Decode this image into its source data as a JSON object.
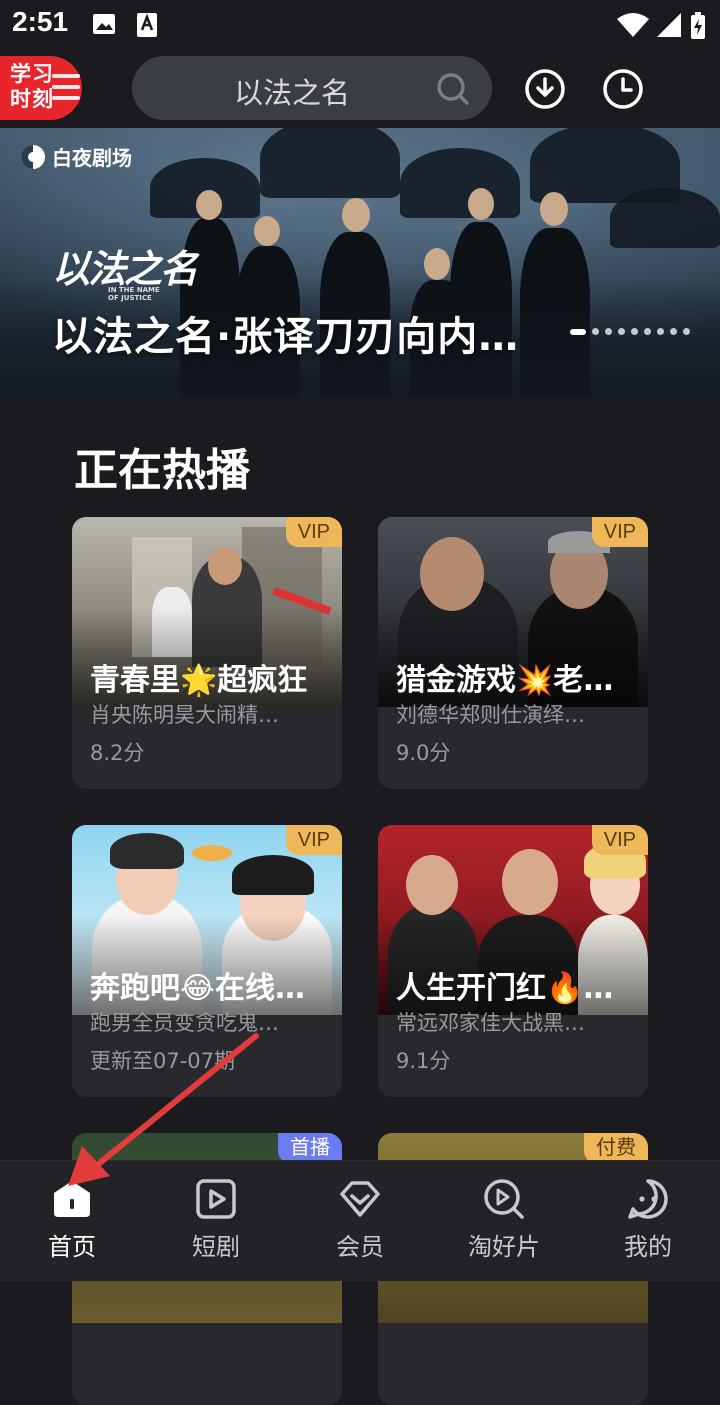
{
  "status_bar": {
    "time": "2:51"
  },
  "header": {
    "badge_text": "学习时刻",
    "search_placeholder": "以法之名"
  },
  "banner": {
    "channel": "白夜剧场",
    "brand_calligraphy": "以法之名",
    "brand_en": "IN THE NAME OF JUSTICE",
    "title": "以法之名·张译刀刃向内…",
    "dot_count": 9,
    "active_dot": 0
  },
  "section": {
    "title": "正在热播"
  },
  "cards": [
    {
      "tag": "VIP",
      "title": "青春里🌟超疯狂",
      "subtitle": "肖央陈明昊大闹精…",
      "meta": "8.2分"
    },
    {
      "tag": "VIP",
      "title": "猎金游戏💥老…",
      "subtitle": "刘德华郑则仕演绎…",
      "meta": "9.0分"
    },
    {
      "tag": "VIP",
      "title": "奔跑吧😂在线…",
      "subtitle": "跑男全员变贪吃鬼…",
      "meta": "更新至07-07期"
    },
    {
      "tag": "VIP",
      "title": "人生开门红🔥…",
      "subtitle": "常远邓家佳大战黑…",
      "meta": "9.1分"
    },
    {
      "tag": "首播"
    },
    {
      "tag": "付费"
    }
  ],
  "bottom_nav": [
    {
      "label": "首页",
      "icon": "home-icon",
      "active": true
    },
    {
      "label": "短剧",
      "icon": "short-drama-icon",
      "active": false
    },
    {
      "label": "会员",
      "icon": "vip-diamond-icon",
      "active": false
    },
    {
      "label": "淘好片",
      "icon": "discover-icon",
      "active": false
    },
    {
      "label": "我的",
      "icon": "profile-icon",
      "active": false
    }
  ],
  "colors": {
    "background": "#1b1a1f",
    "badge": "#e8252a",
    "vip": "#eeb85a",
    "first": "#6b7cf2",
    "arrow": "#e23b3b"
  }
}
